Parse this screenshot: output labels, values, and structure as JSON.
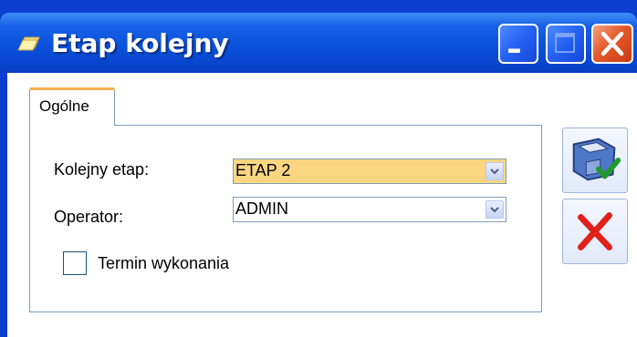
{
  "window": {
    "title": "Etap kolejny",
    "title_icon": "folder-icon",
    "controls": [
      "minimize-icon",
      "maximize-icon",
      "close-icon"
    ]
  },
  "tabs": [
    {
      "label": "Ogólne",
      "active": true
    }
  ],
  "form": {
    "next_stage": {
      "label": "Kolejny etap:",
      "value": "ETAP 2",
      "highlight_color": "#fbd682"
    },
    "operator": {
      "label": "Operator:",
      "value": "ADMIN"
    },
    "deadline": {
      "label": "Termin wykonania",
      "checked": false
    }
  },
  "actions": {
    "save_icon": "save-icon",
    "cancel_icon": "cancel-icon"
  },
  "colors": {
    "titlebar": "#0a52dc",
    "tab_accent": "#f2b34c",
    "border": "#7f9db9",
    "close_button": "#e45a2c"
  }
}
